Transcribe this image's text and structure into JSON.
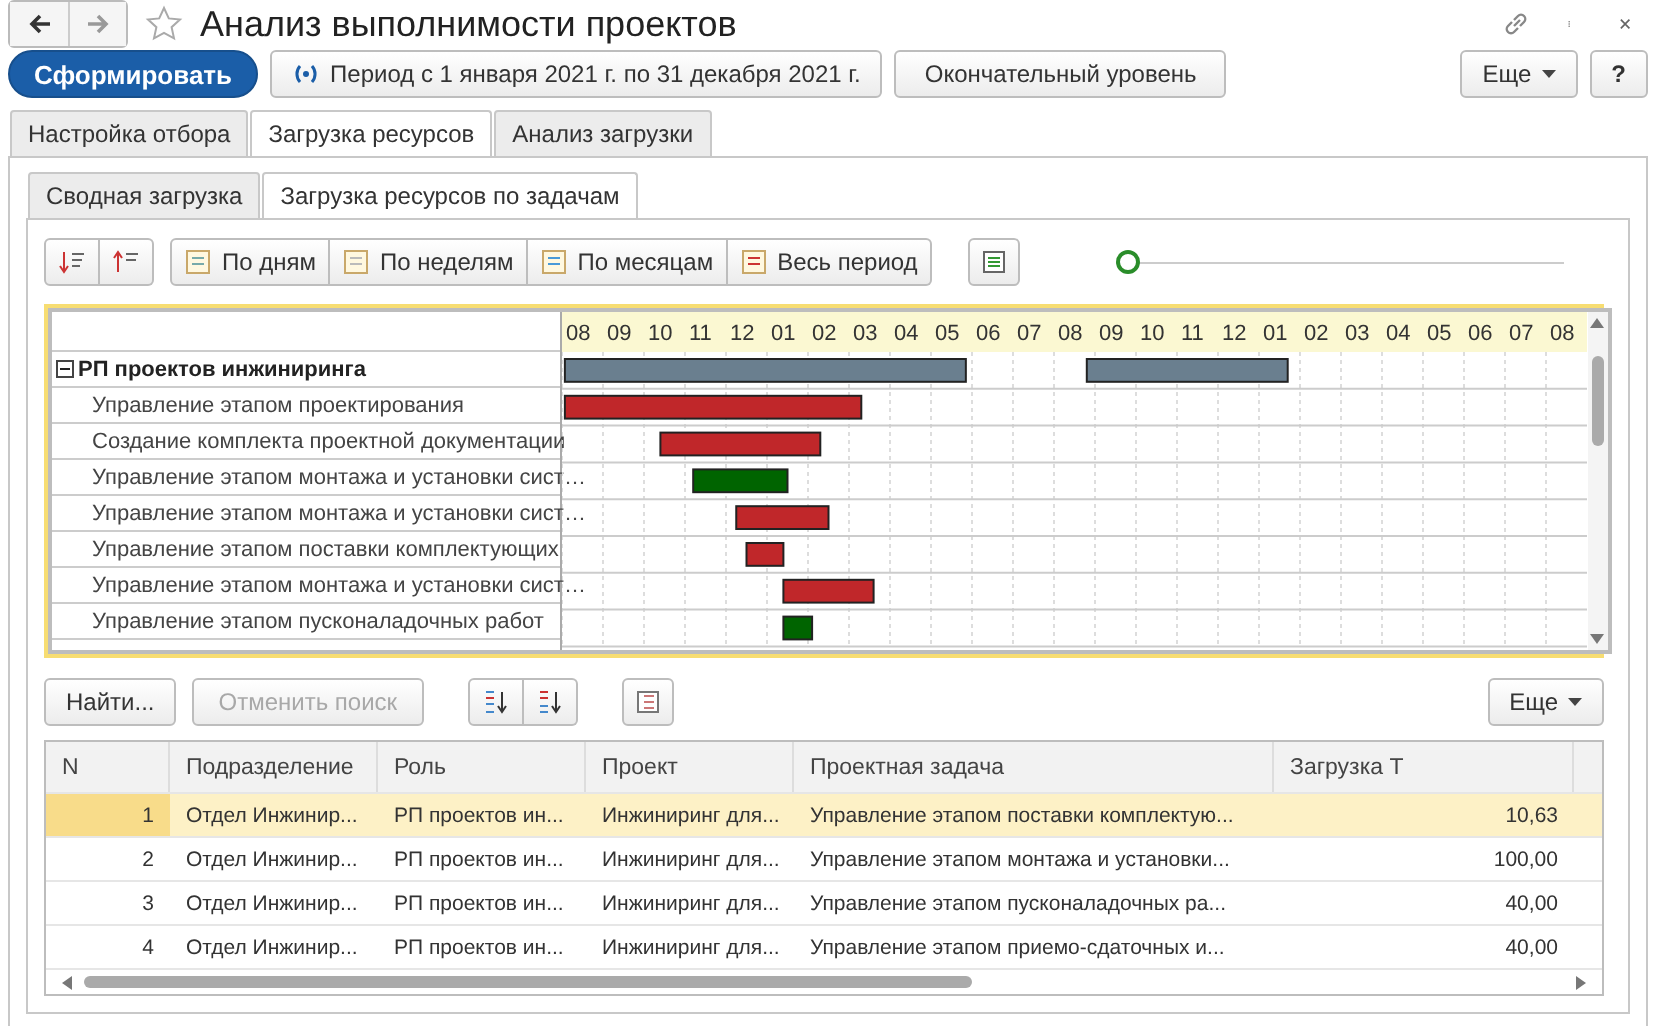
{
  "window": {
    "title": "Анализ выполнимости проектов",
    "favorite": false
  },
  "toolbar": {
    "primary": "Сформировать",
    "period": "Период с 1 января 2021 г. по 31 декабря 2021 г.",
    "level_button": "Окончательный уровень",
    "more": "Еще",
    "help": "?"
  },
  "tabs": [
    {
      "label": "Настройка отбора",
      "selected": false
    },
    {
      "label": "Загрузка ресурсов",
      "selected": true
    },
    {
      "label": "Анализ загрузки",
      "selected": false
    }
  ],
  "subtabs": [
    {
      "label": "Сводная загрузка",
      "selected": false
    },
    {
      "label": "Загрузка ресурсов по задачам",
      "selected": true
    }
  ],
  "scale_buttons": [
    "По дням",
    "По неделям",
    "По месяцам",
    "Весь период"
  ],
  "zoom_slider": {
    "level": 0
  },
  "gantt": {
    "months": [
      "08",
      "09",
      "10",
      "11",
      "12",
      "01",
      "02",
      "03",
      "04",
      "05",
      "06",
      "07",
      "08",
      "09",
      "10",
      "11",
      "12",
      "01",
      "02",
      "03",
      "04",
      "05",
      "06",
      "07",
      "08"
    ],
    "rows": [
      {
        "label": "РП проектов инжиниринга",
        "kind": "group",
        "expanded": true,
        "bars": [
          {
            "color": "#6a7f8f"
          },
          {
            "color": "#6a7f8f"
          }
        ]
      },
      {
        "label": "Управление этапом проектирования",
        "kind": "task",
        "bars": [
          {
            "color": "#c0272a"
          }
        ]
      },
      {
        "label": "Создание комплекта проектной документации",
        "kind": "task",
        "bars": [
          {
            "color": "#c0272a"
          }
        ]
      },
      {
        "label": "Управление этапом монтажа и установки сист…",
        "kind": "task",
        "bars": [
          {
            "color": "#006400"
          }
        ]
      },
      {
        "label": "Управление этапом монтажа и установки сист…",
        "kind": "task",
        "bars": [
          {
            "color": "#c0272a"
          }
        ]
      },
      {
        "label": "Управление этапом поставки комплектующих",
        "kind": "task",
        "bars": [
          {
            "color": "#c0272a"
          }
        ]
      },
      {
        "label": "Управление этапом монтажа и установки сист…",
        "kind": "task",
        "bars": [
          {
            "color": "#c0272a"
          }
        ]
      },
      {
        "label": "Управление этапом пусконаладочных работ",
        "kind": "task",
        "bars": [
          {
            "color": "#006400"
          }
        ]
      }
    ]
  },
  "list_toolbar": {
    "find": "Найти...",
    "cancel": {
      "label": "Отменить поиск",
      "disabled": true
    },
    "more": "Еще"
  },
  "table": {
    "columns": [
      "N",
      "Подразделение",
      "Роль",
      "Проект",
      "Проектная задача",
      "Загрузка Т"
    ],
    "rows": [
      {
        "selected": true,
        "cells": [
          "1",
          "Отдел Инжинир...",
          "РП проектов ин...",
          "Инжиниринг для...",
          "Управление этапом поставки комплектую...",
          "10,63"
        ]
      },
      {
        "selected": false,
        "cells": [
          "2",
          "Отдел Инжинир...",
          "РП проектов ин...",
          "Инжиниринг для...",
          "Управление этапом монтажа и установки...",
          "100,00"
        ]
      },
      {
        "selected": false,
        "cells": [
          "3",
          "Отдел Инжинир...",
          "РП проектов ин...",
          "Инжиниринг для...",
          "Управление этапом пусконаладочных ра...",
          "40,00"
        ]
      },
      {
        "selected": false,
        "cells": [
          "4",
          "Отдел Инжинир...",
          "РП проектов ин...",
          "Инжиниринг для...",
          "Управление этапом приемо-сдаточных и...",
          "40,00"
        ]
      }
    ]
  }
}
